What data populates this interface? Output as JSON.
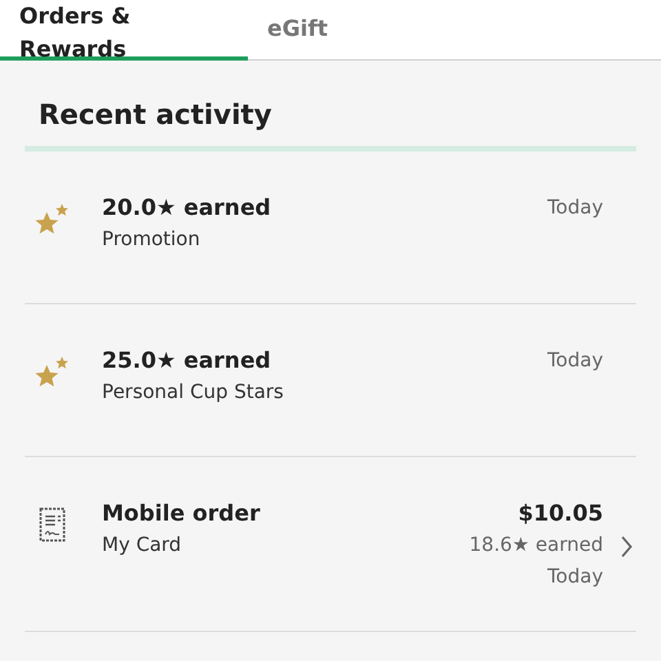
{
  "tabs": [
    {
      "label": "Orders & Rewards",
      "selected": true
    },
    {
      "label": "eGift",
      "selected": false
    }
  ],
  "section": {
    "title": "Recent activity"
  },
  "activities": [
    {
      "kind": "stars",
      "title": "20.0★ earned",
      "subtitle": "Promotion",
      "date": "Today"
    },
    {
      "kind": "stars",
      "title": "25.0★ earned",
      "subtitle": "Personal Cup Stars",
      "date": "Today"
    },
    {
      "kind": "order",
      "title": "Mobile order",
      "subtitle": "My Card",
      "amount": "$10.05",
      "earned": "18.6★ earned",
      "date": "Today"
    }
  ]
}
